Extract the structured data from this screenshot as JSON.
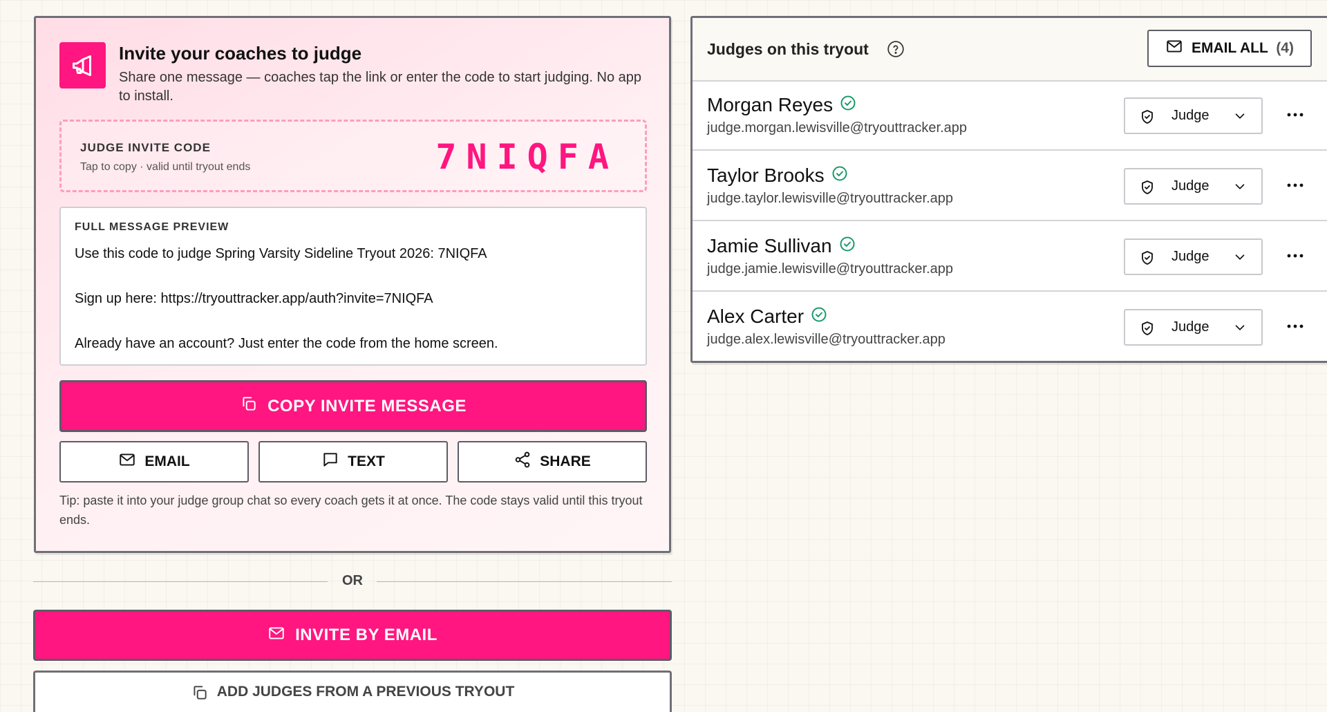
{
  "invite_card": {
    "title": "Invite your coaches to judge",
    "subtitle": "Share one message — coaches tap the link or enter the code to start judging. No app to install.",
    "header_icon": "megaphone-icon",
    "code_label": "JUDGE INVITE CODE",
    "code_hint": "Tap to copy · valid until tryout ends",
    "code": "7NIQFA",
    "preview_label": "FULL MESSAGE PREVIEW",
    "preview_lines": [
      "Use this code to judge Spring Varsity Sideline Tryout 2026: 7NIQFA",
      "Sign up here: https://tryouttracker.app/auth?invite=7NIQFA",
      "Already have an account? Just enter the code from the home screen."
    ],
    "copy_label": "COPY INVITE MESSAGE",
    "share_buttons": [
      {
        "label": "EMAIL",
        "icon": "mail-icon"
      },
      {
        "label": "TEXT",
        "icon": "message-icon"
      },
      {
        "label": "SHARE",
        "icon": "share-icon"
      }
    ],
    "tip": "Tip: paste it into your judge group chat so every coach gets it at once. The code stays valid until this tryout ends."
  },
  "divider_label": "OR",
  "invite_by_email_label": "INVITE BY EMAIL",
  "add_previous_label": "ADD JUDGES FROM A PREVIOUS TRYOUT",
  "judges_panel": {
    "title": "Judges on this tryout",
    "email_all_label": "EMAIL ALL",
    "email_all_count": "(4)",
    "judges": [
      {
        "name": "Morgan Reyes",
        "email": "judge.morgan.lewisville@tryouttracker.app",
        "role": "Judge",
        "verified": true
      },
      {
        "name": "Taylor Brooks",
        "email": "judge.taylor.lewisville@tryouttracker.app",
        "role": "Judge",
        "verified": true
      },
      {
        "name": "Jamie Sullivan",
        "email": "judge.jamie.lewisville@tryouttracker.app",
        "role": "Judge",
        "verified": true
      },
      {
        "name": "Alex Carter",
        "email": "judge.alex.lewisville@tryouttracker.app",
        "role": "Judge",
        "verified": true
      }
    ]
  },
  "colors": {
    "accent": "#ff1680",
    "verified": "#1a9a6a",
    "border": "#6f6f78",
    "background": "#fbf8f1"
  }
}
